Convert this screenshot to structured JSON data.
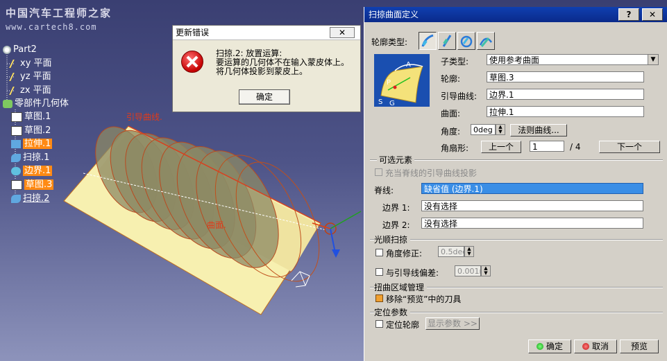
{
  "watermark": {
    "line1": "中国汽车工程师之家",
    "line2": "www.cartech8.com"
  },
  "tree": {
    "root": "Part2",
    "items": [
      {
        "label": "xy 平面"
      },
      {
        "label": "yz 平面"
      },
      {
        "label": "zx 平面"
      },
      {
        "label": "零部件几何体"
      },
      {
        "label": "草图.1"
      },
      {
        "label": "草图.2"
      },
      {
        "label": "拉伸.1"
      },
      {
        "label": "扫掠.1"
      },
      {
        "label": "边界.1"
      },
      {
        "label": "草图.3"
      },
      {
        "label": "扫掠.2"
      }
    ]
  },
  "viewport": {
    "guide_label": "引导曲线.",
    "surface_label": "曲面."
  },
  "error_dialog": {
    "title": "更新错误",
    "close": "✕",
    "line1": "扫掠.2: 放置运算:",
    "line2": "要运算的几何体不在输入蒙皮体上。",
    "line3": "将几何体投影到蒙皮上。",
    "ok": "确定"
  },
  "panel": {
    "title": "扫掠曲面定义",
    "help": "?",
    "close": "✕",
    "profile_type_label": "轮廓类型:",
    "subtype_label": "子类型:",
    "subtype_value": "使用参考曲面",
    "profile_label": "轮廓:",
    "profile_value": "草图.3",
    "guide_label": "引导曲线:",
    "guide_value": "边界.1",
    "surface_label": "曲面:",
    "surface_value": "拉伸.1",
    "angle_label": "角度:",
    "angle_value": "0deg",
    "law_button": "法则曲线...",
    "sector_label": "角扇形:",
    "prev_button": "上一个",
    "sector_index": "1",
    "sector_total": "/ 4",
    "next_button": "下一个",
    "optional_header": "可选元素",
    "project_guide": "充当脊线的引导曲线投影",
    "spine_label": "脊线:",
    "spine_value": "缺省值 (边界.1)",
    "boundary1_label": "边界 1:",
    "boundary1_value": "没有选择",
    "boundary2_label": "边界 2:",
    "boundary2_value": "没有选择",
    "smooth_header": "光顺扫掠",
    "angle_correction": "角度修正:",
    "angle_correction_value": "0.5deg",
    "guide_deviation": "与引导线偏差:",
    "guide_deviation_value": "0.001m",
    "twist_header": "扭曲区域管理",
    "remove_tools": "移除“预览”中的刀具",
    "position_header": "定位参数",
    "position_profile": "定位轮廓",
    "show_params": "显示参数 >>",
    "ok": "确定",
    "cancel": "取消",
    "preview": "预览",
    "diagram_labels": {
      "a": "A",
      "p": "P",
      "s": "S",
      "g": "G"
    }
  },
  "colors": {
    "highlight": "#ff8a14",
    "title_blue": "#0a2a8a",
    "spine_blue": "#3a8ee6"
  }
}
